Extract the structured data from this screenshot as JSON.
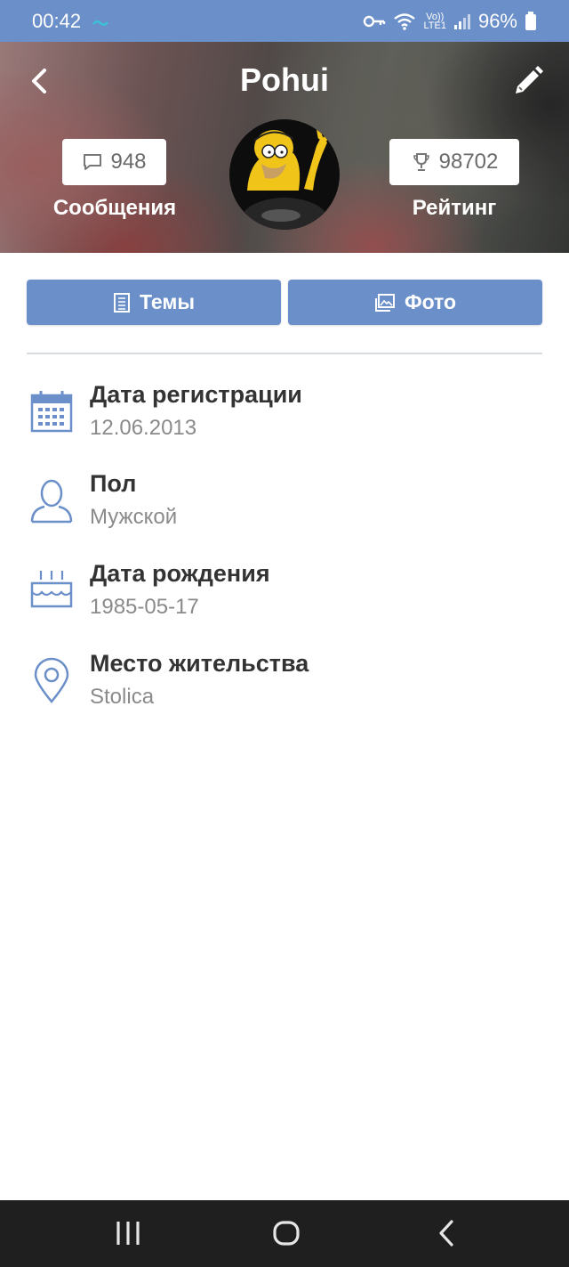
{
  "status_bar": {
    "time": "00:42",
    "battery": "96%",
    "network_top": "Vo))",
    "network_bottom": "LTE1"
  },
  "header": {
    "title": "Pohui",
    "messages_count": "948",
    "messages_label": "Сообщения",
    "rating_count": "98702",
    "rating_label": "Рейтинг"
  },
  "buttons": {
    "topics_label": "Темы",
    "photo_label": "Фото"
  },
  "info": [
    {
      "label": "Дата регистрации",
      "value": "12.06.2013",
      "icon": "calendar-icon"
    },
    {
      "label": "Пол",
      "value": "Мужской",
      "icon": "person-icon"
    },
    {
      "label": "Дата рождения",
      "value": "1985-05-17",
      "icon": "birthday-cake-icon"
    },
    {
      "label": "Место жительства",
      "value": "Stolica",
      "icon": "location-pin-icon"
    }
  ],
  "colors": {
    "accent": "#6b8fc9",
    "nav_bar": "#1f1f1f"
  }
}
